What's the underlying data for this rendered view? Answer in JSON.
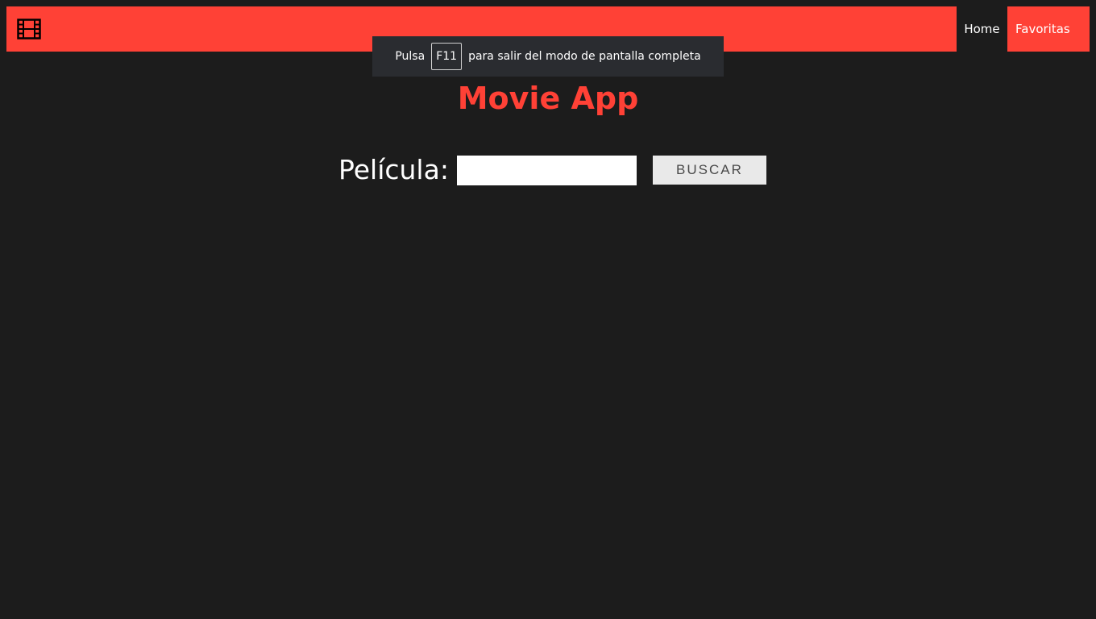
{
  "navbar": {
    "logo_icon": "film-icon",
    "links": [
      {
        "label": "Home"
      },
      {
        "label": "Favoritas"
      }
    ],
    "accent_color": "#ff4136"
  },
  "fullscreen_toast": {
    "prefix": "Pulsa",
    "key": "F11",
    "suffix": "para salir del modo de pantalla completa"
  },
  "main": {
    "title": "Movie App",
    "search": {
      "label": "Película:",
      "value": "",
      "placeholder": "",
      "button_label": "BUSCAR"
    }
  },
  "colors": {
    "background": "#1c1c1c",
    "accent": "#ff4136",
    "button_bg": "#e9e9e9"
  }
}
